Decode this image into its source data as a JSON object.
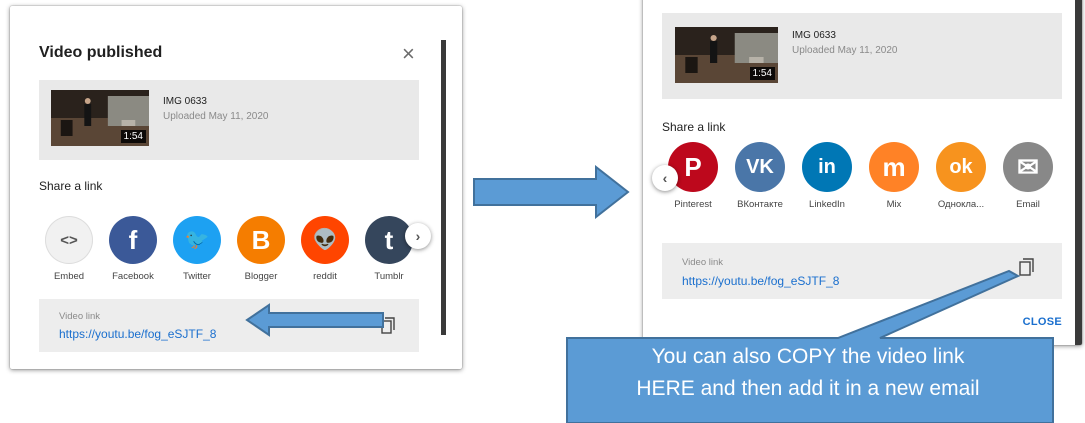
{
  "left_dialog": {
    "title": "Video published",
    "close_glyph": "×",
    "video": {
      "title": "IMG 0633",
      "date": "Uploaded May 11, 2020",
      "duration": "1:54"
    },
    "share_label": "Share a link",
    "share_items": [
      {
        "name": "Embed",
        "icon": "code-icon",
        "glyph": "<>",
        "color": "#f1f1f1",
        "fg": "#555555"
      },
      {
        "name": "Facebook",
        "icon": "facebook-icon",
        "glyph": "f",
        "color": "#3b5998",
        "fg": "#ffffff"
      },
      {
        "name": "Twitter",
        "icon": "twitter-icon",
        "glyph": "🐦",
        "color": "#1da1f2",
        "fg": "#ffffff"
      },
      {
        "name": "Blogger",
        "icon": "blogger-icon",
        "glyph": "B",
        "color": "#f57d00",
        "fg": "#ffffff"
      },
      {
        "name": "reddit",
        "icon": "reddit-icon",
        "glyph": "👽",
        "color": "#ff4500",
        "fg": "#ffffff"
      },
      {
        "name": "Tumblr",
        "icon": "tumblr-icon",
        "glyph": "t",
        "color": "#35465c",
        "fg": "#ffffff"
      }
    ],
    "next_glyph": "›",
    "link_label": "Video link",
    "link_url": "https://youtu.be/fog_eSJTF_8"
  },
  "right_dialog": {
    "video": {
      "title": "IMG 0633",
      "date": "Uploaded May 11, 2020",
      "duration": "1:54"
    },
    "share_label": "Share a link",
    "prev_glyph": "‹",
    "share_items": [
      {
        "name": "Pinterest",
        "icon": "pinterest-icon",
        "glyph": "P",
        "color": "#bd081c",
        "fg": "#ffffff"
      },
      {
        "name": "ВКонтакте",
        "icon": "vk-icon",
        "glyph": "VK",
        "color": "#4a76a8",
        "fg": "#ffffff"
      },
      {
        "name": "LinkedIn",
        "icon": "linkedin-icon",
        "glyph": "in",
        "color": "#0077b5",
        "fg": "#ffffff"
      },
      {
        "name": "Mix",
        "icon": "mix-icon",
        "glyph": "m",
        "color": "#ff8226",
        "fg": "#ffffff"
      },
      {
        "name": "Однокла...",
        "icon": "odnoklassniki-icon",
        "glyph": "ok",
        "color": "#f7931e",
        "fg": "#ffffff"
      },
      {
        "name": "Email",
        "icon": "email-icon",
        "glyph": "✉",
        "color": "#888888",
        "fg": "#ffffff"
      }
    ],
    "link_label": "Video link",
    "link_url": "https://youtu.be/fog_eSJTF_8",
    "close_label": "CLOSE"
  },
  "callout": {
    "line1": "You can also COPY the video link",
    "line2": "HERE and then add it in a new email",
    "fill": "#5b9bd5"
  }
}
